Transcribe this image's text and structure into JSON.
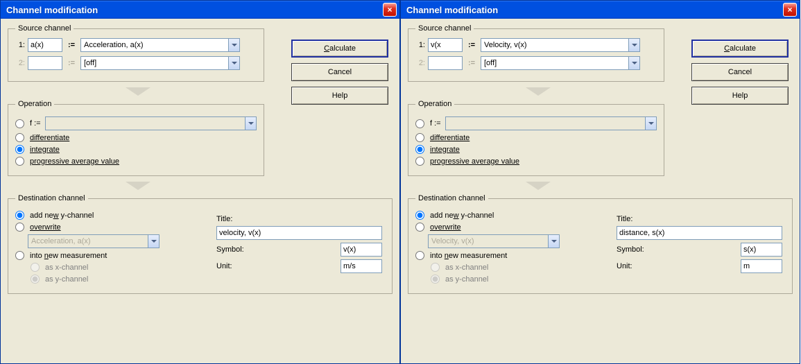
{
  "windows": [
    {
      "title": "Channel modification",
      "buttons": {
        "calculate": "Calculate",
        "cancel": "Cancel",
        "help": "Help"
      },
      "source": {
        "legend": "Source channel",
        "rows": [
          {
            "num": "1:",
            "var": "a(x)",
            "assign": ":=",
            "channel": "Acceleration, a(x)",
            "enabled": true
          },
          {
            "num": "2:",
            "var": "",
            "assign": ":=",
            "channel": "[off]",
            "enabled": false
          }
        ]
      },
      "operation": {
        "legend": "Operation",
        "f_label": "f :=",
        "f_value": "",
        "diff": "differentiate",
        "integ": "integrate",
        "pav": "progressive average value",
        "selected": "integ"
      },
      "dest": {
        "legend": "Destination channel",
        "addnew": "add new y-channel",
        "overwrite": "overwrite",
        "over_value": "Acceleration, a(x)",
        "intonew": "into new measurement",
        "asx": "as x-channel",
        "asy": "as y-channel",
        "selected": "addnew",
        "title_label": "Title:",
        "title_value": "velocity, v(x)",
        "symbol_label": "Symbol:",
        "symbol_value": "v(x)",
        "unit_label": "Unit:",
        "unit_value": "m/s"
      }
    },
    {
      "title": "Channel modification",
      "buttons": {
        "calculate": "Calculate",
        "cancel": "Cancel",
        "help": "Help"
      },
      "source": {
        "legend": "Source channel",
        "rows": [
          {
            "num": "1:",
            "var": "v(x",
            "assign": ":=",
            "channel": "Velocity, v(x)",
            "enabled": true
          },
          {
            "num": "2:",
            "var": "",
            "assign": ":=",
            "channel": "[off]",
            "enabled": false
          }
        ]
      },
      "operation": {
        "legend": "Operation",
        "f_label": "f :=",
        "f_value": "",
        "diff": "differentiate",
        "integ": "integrate",
        "pav": "progressive average value",
        "selected": "integ"
      },
      "dest": {
        "legend": "Destination channel",
        "addnew": "add new y-channel",
        "overwrite": "overwrite",
        "over_value": "Velocity, v(x)",
        "intonew": "into new measurement",
        "asx": "as x-channel",
        "asy": "as y-channel",
        "selected": "addnew",
        "title_label": "Title:",
        "title_value": "distance, s(x)",
        "symbol_label": "Symbol:",
        "symbol_value": "s(x)",
        "unit_label": "Unit:",
        "unit_value": "m"
      }
    }
  ]
}
